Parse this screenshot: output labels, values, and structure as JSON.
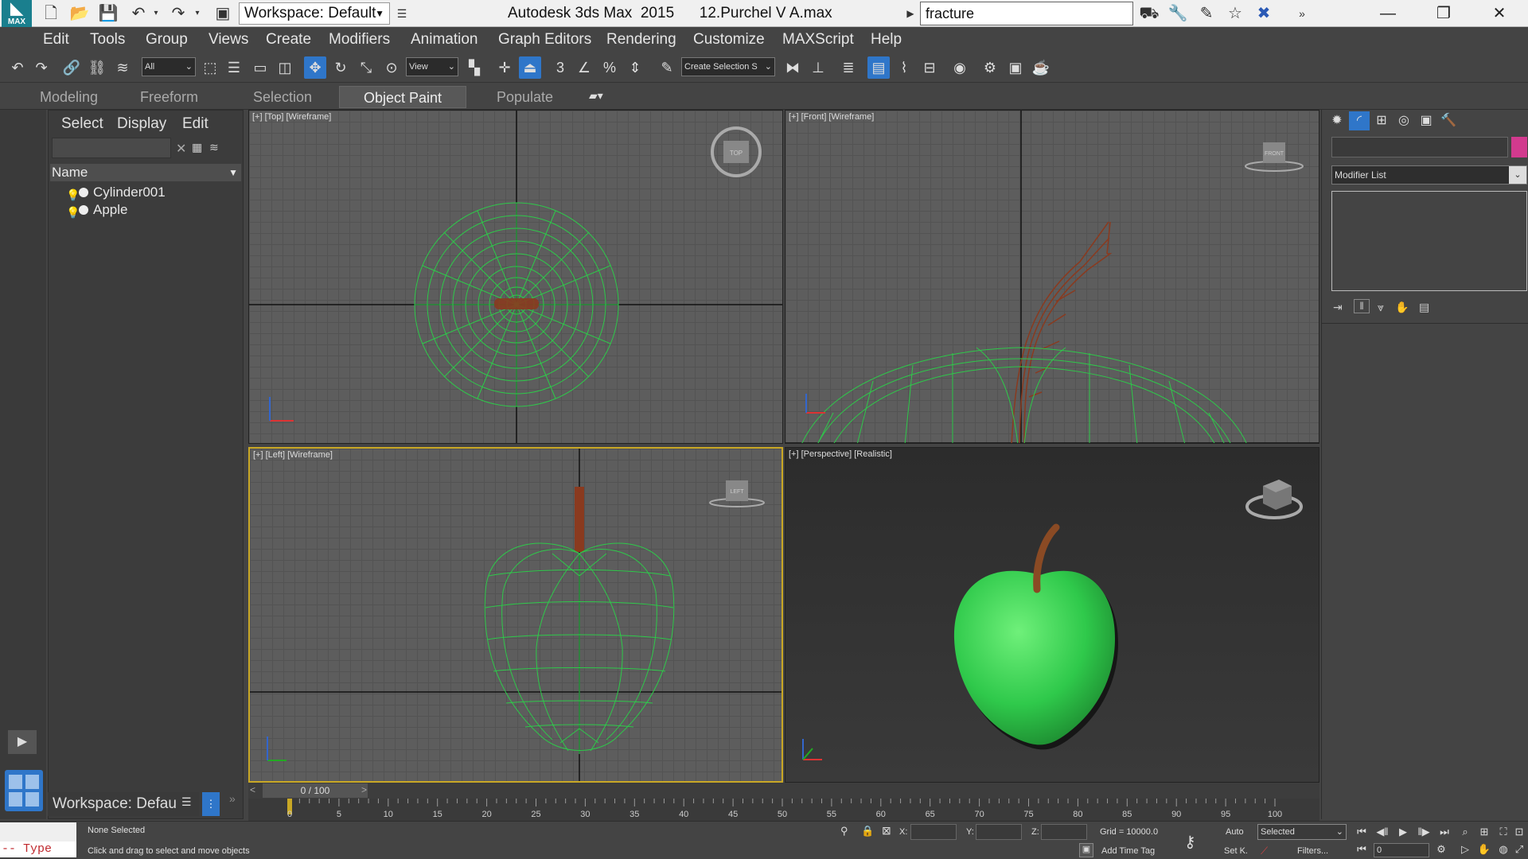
{
  "app": {
    "logo_text": "MAX",
    "workspace_selector": "Workspace: Default",
    "title": "Autodesk 3ds Max  2015      12.Purchel V A.max",
    "search_value": "fracture"
  },
  "menu": [
    "Edit",
    "Tools",
    "Group",
    "Views",
    "Create",
    "Modifiers",
    "Animation",
    "Graph Editors",
    "Rendering",
    "Customize",
    "MAXScript",
    "Help"
  ],
  "toolbar": {
    "selection_filter": "All",
    "reference_coord": "View",
    "named_selection": "Create Selection S",
    "snap_labels": [
      "3",
      "%"
    ]
  },
  "ribbon": {
    "tabs": [
      "Modeling",
      "Freeform",
      "Selection",
      "Object Paint",
      "Populate"
    ],
    "active_tab": "Object Paint"
  },
  "scene_explorer": {
    "menu": [
      "Select",
      "Display",
      "Edit"
    ],
    "column_header": "Name",
    "items": [
      "Cylinder001",
      "Apple"
    ],
    "workspace_label": "Workspace: Defau"
  },
  "viewports": {
    "top": {
      "label": "[+] [Top] [Wireframe]",
      "cube_label": "TOP"
    },
    "front": {
      "label": "[+] [Front] [Wireframe]",
      "cube_label": "FRONT"
    },
    "left": {
      "label": "[+] [Left] [Wireframe]",
      "cube_label": "LEFT"
    },
    "perspective": {
      "label": "[+] [Perspective] [Realistic]"
    }
  },
  "command_panel": {
    "modifier_list": "Modifier List",
    "color_swatch": "#d23a8e"
  },
  "timeline": {
    "slider_label": "0 / 100",
    "ticks": [
      "0",
      "5",
      "10",
      "15",
      "20",
      "25",
      "30",
      "35",
      "40",
      "45",
      "50",
      "55",
      "60",
      "65",
      "70",
      "75",
      "80",
      "85",
      "90",
      "95",
      "100"
    ]
  },
  "status": {
    "maxscript_prompt": "-- Type",
    "selection_status": "None Selected",
    "prompt": "Click and drag to select and move objects",
    "x_label": "X:",
    "y_label": "Y:",
    "z_label": "Z:",
    "grid": "Grid = 10000.0",
    "add_time_tag": "Add Time Tag",
    "auto_key": "Auto",
    "set_key": "Set K.",
    "key_filter": "Selected",
    "filters": "Filters...",
    "current_frame": "0"
  },
  "colors": {
    "wireframe_green": "#2ec94a",
    "stem_brown": "#8a3a1f",
    "active_blue": "#2f76c9"
  }
}
